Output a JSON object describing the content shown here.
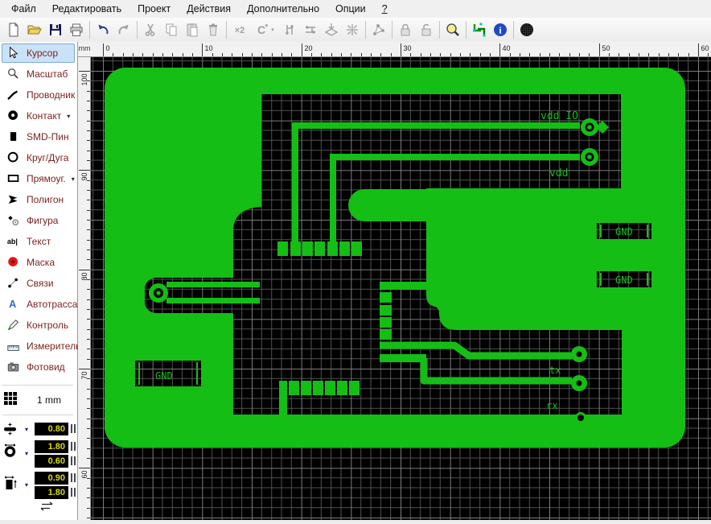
{
  "menu": {
    "items": [
      {
        "id": "file",
        "label": "Файл"
      },
      {
        "id": "edit",
        "label": "Редактировать"
      },
      {
        "id": "project",
        "label": "Проект"
      },
      {
        "id": "actions",
        "label": "Действия"
      },
      {
        "id": "extras",
        "label": "Дополнительно"
      },
      {
        "id": "options",
        "label": "Опции"
      },
      {
        "id": "help",
        "label": "?"
      }
    ]
  },
  "toolbar": {
    "items": [
      {
        "id": "new",
        "enabled": true
      },
      {
        "id": "open",
        "enabled": true
      },
      {
        "id": "save",
        "enabled": true
      },
      {
        "id": "print",
        "enabled": true
      },
      {
        "sep": true
      },
      {
        "id": "undo",
        "enabled": true
      },
      {
        "id": "redo",
        "enabled": false
      },
      {
        "sep": true
      },
      {
        "id": "cut",
        "enabled": false
      },
      {
        "id": "copy",
        "enabled": false
      },
      {
        "id": "paste",
        "enabled": false
      },
      {
        "id": "delete",
        "enabled": false
      },
      {
        "sep": true
      },
      {
        "id": "scale-x2",
        "enabled": false
      },
      {
        "id": "rotate",
        "enabled": false,
        "dropdown": true
      },
      {
        "id": "mirror-h",
        "enabled": false
      },
      {
        "id": "mirror-v",
        "enabled": false
      },
      {
        "id": "to-layer",
        "enabled": false
      },
      {
        "id": "center",
        "enabled": false
      },
      {
        "sep": true
      },
      {
        "id": "connections",
        "enabled": false
      },
      {
        "sep": true
      },
      {
        "id": "lock",
        "enabled": false
      },
      {
        "id": "unlock",
        "enabled": false
      },
      {
        "sep": true
      },
      {
        "id": "zoom",
        "enabled": true
      },
      {
        "sep": true
      },
      {
        "id": "layers",
        "enabled": true
      },
      {
        "id": "info",
        "enabled": true
      },
      {
        "sep": true
      },
      {
        "id": "photoview",
        "enabled": true
      }
    ]
  },
  "sidebar": {
    "tools": [
      {
        "id": "cursor",
        "label": "Курсор",
        "selected": true
      },
      {
        "id": "zoom",
        "label": "Масштаб"
      },
      {
        "id": "wire",
        "label": "Проводник"
      },
      {
        "id": "contact",
        "label": "Контакт",
        "arrow": true
      },
      {
        "id": "smd-pin",
        "label": "SMD-Пин"
      },
      {
        "id": "circle-arc",
        "label": "Круг/Дуга"
      },
      {
        "id": "rectangle",
        "label": "Прямоуг.",
        "arrow": true
      },
      {
        "id": "polygon",
        "label": "Полигон"
      },
      {
        "id": "shape",
        "label": "Фигура"
      },
      {
        "id": "text",
        "label": "Текст"
      },
      {
        "id": "mask",
        "label": "Маска"
      },
      {
        "id": "links",
        "label": "Связи"
      },
      {
        "id": "autoroute",
        "label": "Автотрасса"
      },
      {
        "id": "control",
        "label": "Контроль"
      },
      {
        "id": "measure",
        "label": "Измеритель"
      },
      {
        "id": "photoview",
        "label": "Фотовид"
      }
    ],
    "grid_label": "1 mm",
    "params": [
      {
        "id": "track-width",
        "values": [
          "0.80"
        ]
      },
      {
        "id": "pad-size",
        "values": [
          "1.80",
          "0.60"
        ]
      },
      {
        "id": "smd-size",
        "values": [
          "0.90",
          "1.80"
        ]
      }
    ]
  },
  "rulers": {
    "unit": "mm",
    "h_labels": [
      0,
      10,
      20,
      30,
      40,
      50,
      60
    ],
    "v_labels": [
      100,
      90,
      80,
      70,
      60
    ]
  },
  "pcb": {
    "labels": {
      "vdd_io": "vdd IO",
      "vdd": "vdd",
      "gnd": "GND",
      "tx": "tx",
      "rx": "rx"
    },
    "colors": {
      "copper": "#14be14",
      "background": "#000000",
      "grid_minor": "#525252",
      "grid_major": "#7d7d7d"
    }
  }
}
